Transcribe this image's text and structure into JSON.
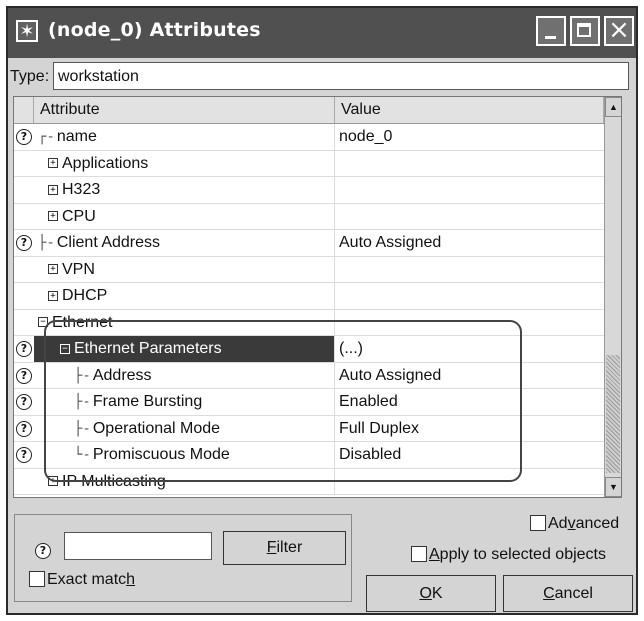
{
  "window": {
    "title": "(node_0) Attributes",
    "icon": "star-icon"
  },
  "type_field": {
    "label": "Type:",
    "value": "workstation"
  },
  "grid": {
    "columns": {
      "attribute": "Attribute",
      "value": "Value"
    },
    "rows": [
      {
        "help": true,
        "expander": "",
        "prefix": "┌-",
        "indent": 0,
        "label": "name",
        "value": "node_0"
      },
      {
        "help": false,
        "expander": "+",
        "prefix": "",
        "indent": 1,
        "label": "Applications",
        "value": ""
      },
      {
        "help": false,
        "expander": "+",
        "prefix": "",
        "indent": 1,
        "label": "H323",
        "value": ""
      },
      {
        "help": false,
        "expander": "+",
        "prefix": "",
        "indent": 1,
        "label": "CPU",
        "value": ""
      },
      {
        "help": true,
        "expander": "",
        "prefix": "├-",
        "indent": 0,
        "label": "Client Address",
        "value": "Auto Assigned"
      },
      {
        "help": false,
        "expander": "+",
        "prefix": "",
        "indent": 1,
        "label": "VPN",
        "value": ""
      },
      {
        "help": false,
        "expander": "+",
        "prefix": "",
        "indent": 1,
        "label": "DHCP",
        "value": ""
      },
      {
        "help": false,
        "expander": "−",
        "prefix": "",
        "indent": 0,
        "label": "Ethernet",
        "value": ""
      },
      {
        "help": true,
        "expander": "−",
        "prefix": "",
        "indent": 2,
        "label": "Ethernet Parameters",
        "value": "(...)",
        "selected": true
      },
      {
        "help": true,
        "expander": "",
        "prefix": "├-",
        "indent": 3,
        "label": "Address",
        "value": "Auto Assigned"
      },
      {
        "help": true,
        "expander": "",
        "prefix": "├-",
        "indent": 3,
        "label": "Frame Bursting",
        "value": "Enabled"
      },
      {
        "help": true,
        "expander": "",
        "prefix": "├-",
        "indent": 3,
        "label": "Operational Mode",
        "value": "Full Duplex"
      },
      {
        "help": true,
        "expander": "",
        "prefix": "└-",
        "indent": 3,
        "label": "Promiscuous Mode",
        "value": "Disabled"
      },
      {
        "help": false,
        "expander": "+",
        "prefix": "",
        "indent": 1,
        "label": "IP Multicasting",
        "value": ""
      }
    ]
  },
  "filter": {
    "help_glyph": "?",
    "input_value": "",
    "button": {
      "key": "F",
      "rest": "ilter"
    },
    "exact_match": {
      "before": "Exact matc",
      "key": "h",
      "checked": false
    }
  },
  "advanced": {
    "before": "Ad",
    "key": "v",
    "after": "anced",
    "checked": false
  },
  "apply_selected": {
    "key": "A",
    "rest": "pply to selected objects",
    "checked": false
  },
  "ok_button": {
    "key": "O",
    "rest": "K"
  },
  "cancel_button": {
    "key": "C",
    "rest": "ancel"
  },
  "help_glyph": "?",
  "colors": {
    "titlebar": "#505050",
    "selection": "#3a3a3a",
    "dialog": "#d4d4d4"
  }
}
